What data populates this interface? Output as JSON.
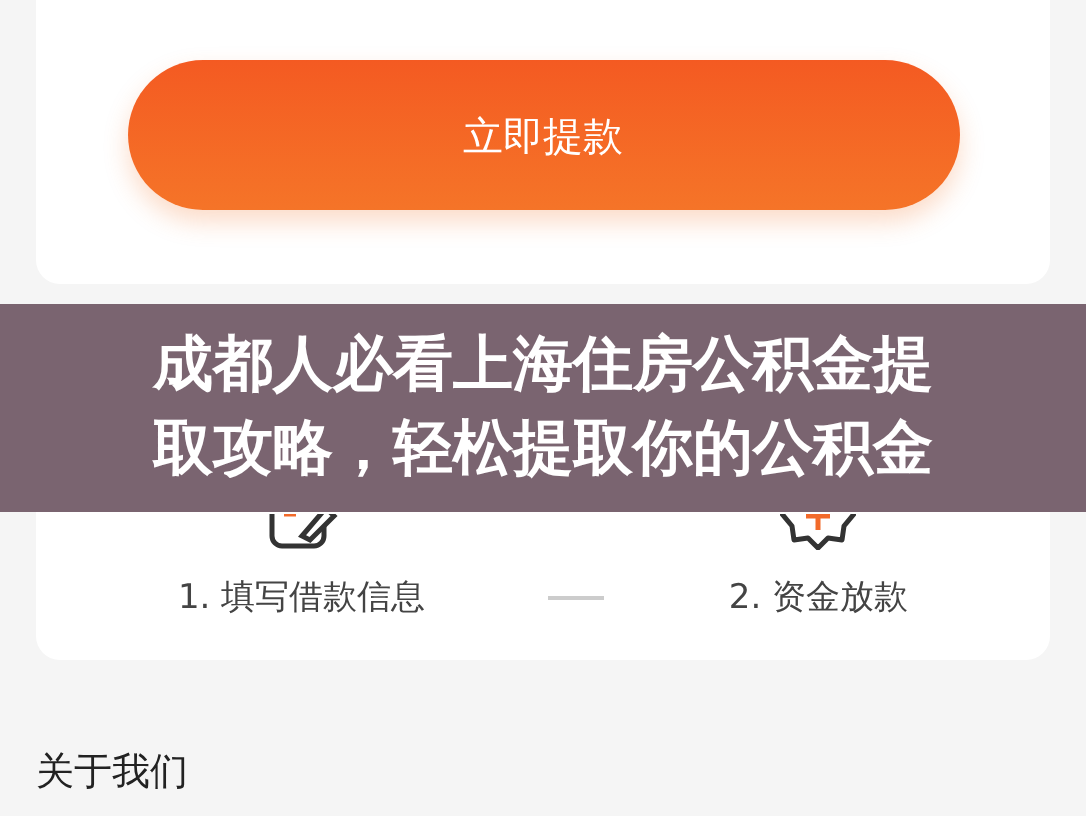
{
  "withdraw_button": {
    "label": "立即提款"
  },
  "steps": [
    {
      "label": "1. 填写借款信息",
      "kind": "form"
    },
    {
      "label": "2. 资金放款",
      "kind": "money"
    }
  ],
  "section_title": "关于我们",
  "banner": {
    "title": "成都人必看上海住房公积金提取攻略，轻松提取你的公积金"
  }
}
